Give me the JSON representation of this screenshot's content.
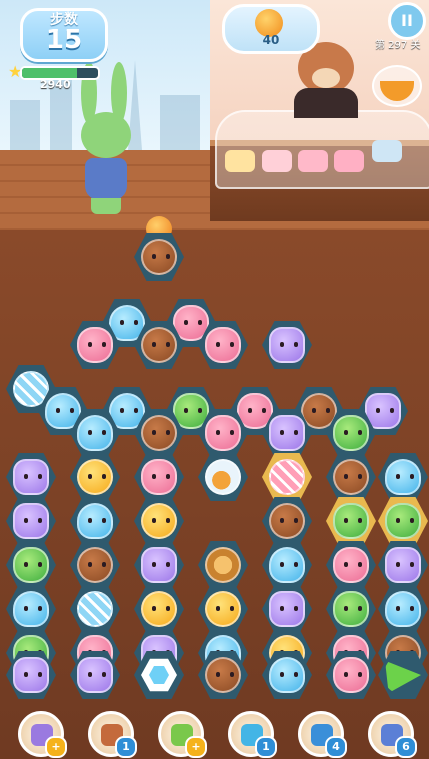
{
  "hud": {
    "moves_label": "步数",
    "moves_value": "15",
    "score": "2940",
    "progress_fraction": 0.72,
    "goal_count": "40",
    "goal_icon": "orange-orb-icon",
    "level_text": "第 297 关",
    "pause_icon": "pause-icon"
  },
  "board": {
    "rows": [
      [
        "",
        "",
        "",
        "",
        "bear",
        "",
        "",
        "",
        ""
      ],
      [
        "",
        "",
        "",
        "blob",
        "",
        "pig",
        "",
        "",
        ""
      ],
      [
        "",
        "",
        "pig",
        "",
        "bear",
        "",
        "pig",
        "",
        "cat"
      ],
      [
        "candy",
        "blob",
        "",
        "blob",
        "",
        "frog",
        "",
        "pig",
        "",
        "bear",
        "",
        "cat"
      ],
      [
        "",
        "",
        "blob",
        "",
        "bear",
        "",
        "pig",
        "",
        "cat",
        "",
        "frog"
      ],
      [
        "cat",
        "",
        "chick",
        "",
        "pig",
        "",
        "orbjar",
        "",
        "candyp",
        "",
        "bear",
        "",
        "blob"
      ],
      [
        "cat",
        "",
        "blob",
        "",
        "chick",
        "",
        "",
        "",
        "bear",
        "",
        "frog",
        "",
        "frog"
      ],
      [
        "frog",
        "",
        "bear",
        "",
        "cat",
        "",
        "lion",
        "",
        "blob",
        "",
        "pig",
        "",
        "cat"
      ],
      [
        "blob",
        "",
        "candy",
        "",
        "chick",
        "",
        "chick",
        "",
        "cat",
        "",
        "frog",
        "",
        "blob"
      ],
      [
        "frog",
        "",
        "pig",
        "",
        "cat",
        "",
        "blob",
        "",
        "chick",
        "",
        "pig",
        "",
        "bear"
      ],
      [
        "cat",
        "",
        "cat",
        "",
        "gem",
        "",
        "bear",
        "",
        "blob",
        "",
        "pig",
        "",
        "tri"
      ]
    ]
  },
  "boosters": [
    {
      "icon": "wand-icon",
      "badge": "+"
    },
    {
      "icon": "drum-icon",
      "badge": "1"
    },
    {
      "icon": "fruit-cluster-icon",
      "badge": "+"
    },
    {
      "icon": "ball-swap-icon",
      "badge": "1"
    },
    {
      "icon": "cookie-box-icon",
      "badge": "4"
    },
    {
      "icon": "hourglass-icon",
      "badge": "6"
    }
  ],
  "colors": {
    "hud_blue": "#8ed0f6",
    "board_slot": "#2f5a6e",
    "wood": "#7a4125"
  }
}
